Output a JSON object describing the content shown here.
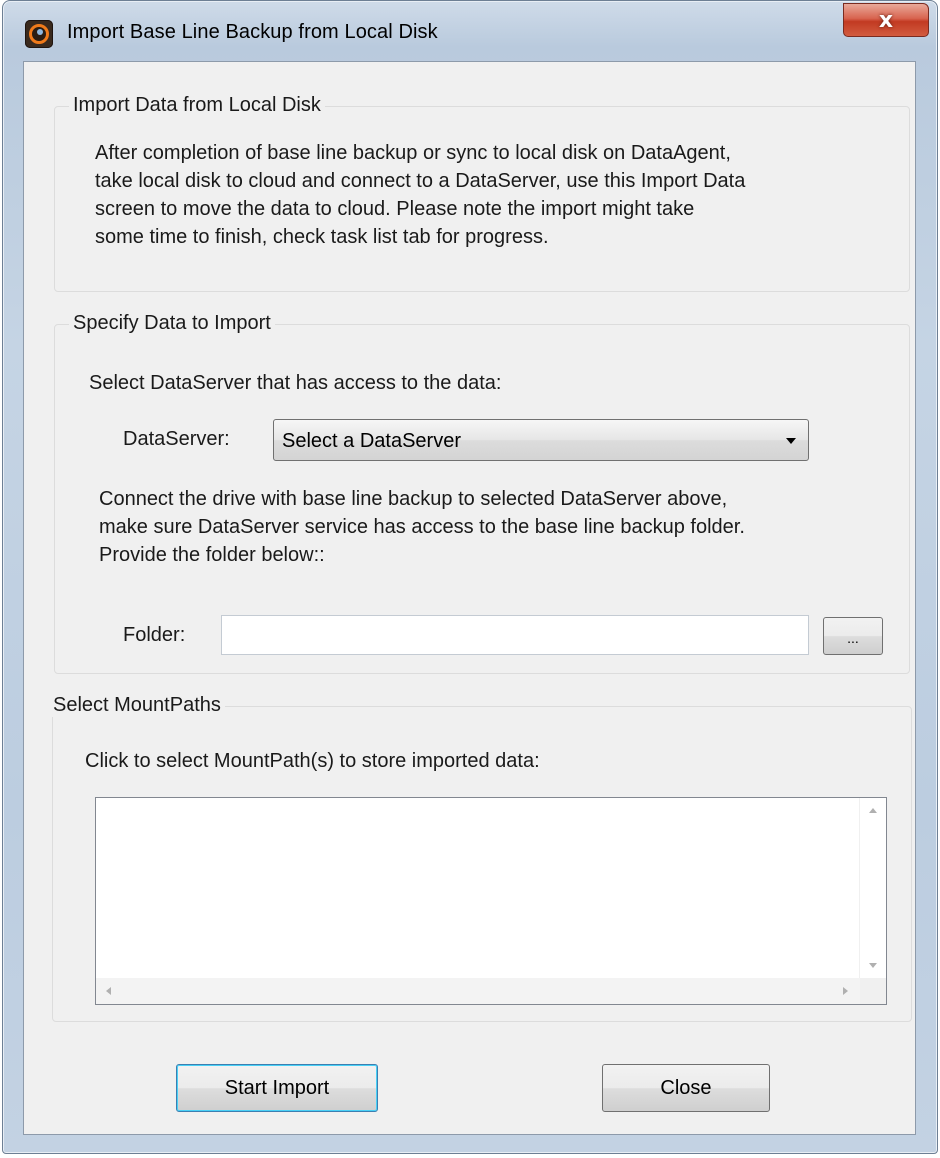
{
  "window": {
    "title": "Import Base Line Backup from Local Disk",
    "close_glyph": "x"
  },
  "import_group": {
    "title": "Import Data from Local Disk",
    "lines": [
      "After completion of base line backup or sync to local disk on DataAgent,",
      "take local disk to cloud and connect to a DataServer, use this Import Data",
      "screen to move the data to cloud. Please note the import might take",
      "some time to finish, check task list tab for progress."
    ]
  },
  "specify_group": {
    "title": "Specify Data to Import",
    "select_prompt": "Select DataServer that has access to the data:",
    "dataserver_label": "DataServer:",
    "dataserver_value": "Select a DataServer",
    "connect_lines": [
      "Connect the drive with base line backup to selected DataServer above,",
      "make sure DataServer service has access to the base line backup folder.",
      "Provide the folder below::"
    ],
    "folder_label": "Folder:",
    "folder_value": "",
    "browse_label": "..."
  },
  "mountpaths_group": {
    "title": "Select MountPaths",
    "prompt": "Click to select MountPath(s) to store imported data:"
  },
  "buttons": {
    "start_import": "Start Import",
    "close": "Close"
  }
}
